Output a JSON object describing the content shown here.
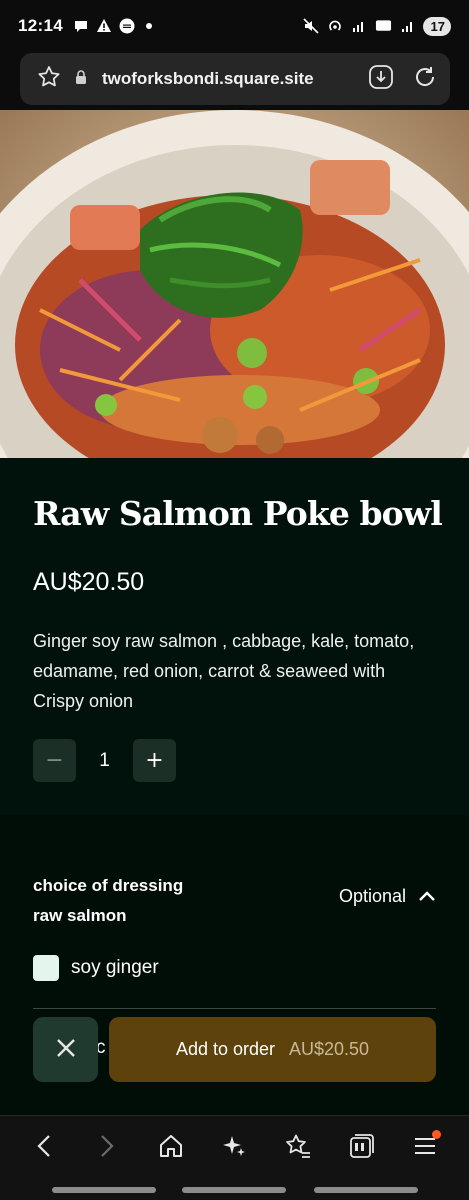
{
  "status_bar": {
    "time": "12:14",
    "battery": "17",
    "left_icons": [
      "talk-bubble-icon",
      "warning-icon",
      "uber-eats-icon"
    ],
    "right_icons": [
      "mute-icon",
      "hotspot-icon",
      "signal-icon",
      "5g-icon",
      "wifi-signal-icon"
    ]
  },
  "browser": {
    "url": "twoforksbondi.square.site"
  },
  "product": {
    "title": "Raw Salmon Poke bowl",
    "price": "AU$20.50",
    "description": "Ginger soy raw salmon , cabbage, kale, tomato, edamame, red onion, carrot & seaweed with Crispy onion",
    "quantity": "1",
    "minus_label": "−",
    "plus_label": "+"
  },
  "modifier": {
    "title": "choice of dressing raw salmon",
    "optional_label": "Optional",
    "choices": [
      {
        "label": "soy ginger",
        "checked": false
      }
    ],
    "next_choice_fragment": "c"
  },
  "actions": {
    "add_label": "Add to order",
    "add_price": "AU$20.50"
  },
  "colors": {
    "content_bg": "#01120c",
    "add_button_bg": "#5e420c",
    "close_button_bg": "#213a30",
    "notification_dot": "#ff5a1f"
  }
}
